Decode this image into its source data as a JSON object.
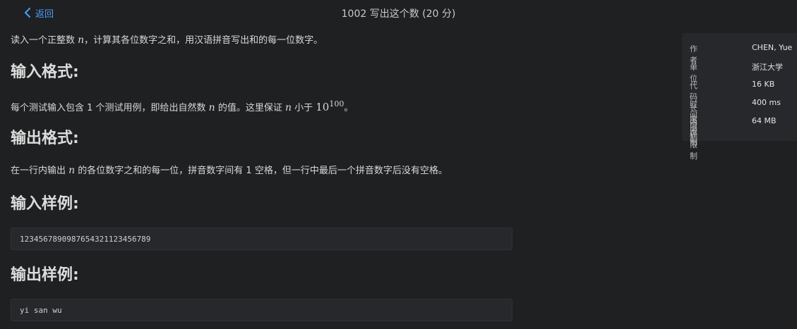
{
  "header": {
    "back_label": "返回",
    "title": "1002 写出这个数 (20 分)"
  },
  "problem": {
    "intro": {
      "a": "读入一个正整数 ",
      "var": "n",
      "b": "，计算其各位数字之和，用汉语拼音写出和的每一位数字。"
    },
    "input_heading": "输入格式:",
    "input_desc": {
      "a": "每个测试输入包含 1 个测试用例，即给出自然数 ",
      "var1": "n",
      "b": " 的值。这里保证 ",
      "var2": "n",
      "c": " 小于 ",
      "base": "10",
      "exp": "100",
      "d": "。"
    },
    "output_heading": "输出格式:",
    "output_desc": {
      "a": "在一行内输出 ",
      "var": "n",
      "b": " 的各位数字之和的每一位，拼音数字间有 1 空格，但一行中最后一个拼音数字后没有空格。"
    },
    "sample_input_heading": "输入样例:",
    "sample_input": "1234567890987654321123456789",
    "sample_output_heading": "输出样例:",
    "sample_output": "yi san wu"
  },
  "info": [
    {
      "label": "作者",
      "value": "CHEN, Yue"
    },
    {
      "label": "单位",
      "value": "浙江大学"
    },
    {
      "label": "代码长度限制",
      "value": "16 KB"
    },
    {
      "label": "时间限制",
      "value": "400 ms"
    },
    {
      "label": "内存限制",
      "value": "64 MB"
    }
  ],
  "colors": {
    "background": "#1f2022",
    "accent": "#4a9eff",
    "panel": "#26282b"
  }
}
